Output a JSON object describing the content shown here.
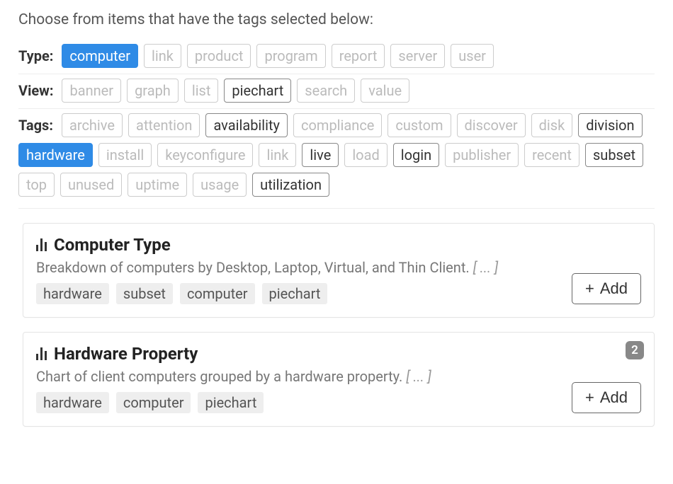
{
  "instruction": "Choose from items that have the tags selected below:",
  "filters": {
    "type": {
      "label": "Type:",
      "items": [
        {
          "label": "computer",
          "state": "selected"
        },
        {
          "label": "link",
          "state": "disabled"
        },
        {
          "label": "product",
          "state": "disabled"
        },
        {
          "label": "program",
          "state": "disabled"
        },
        {
          "label": "report",
          "state": "disabled"
        },
        {
          "label": "server",
          "state": "disabled"
        },
        {
          "label": "user",
          "state": "disabled"
        }
      ]
    },
    "view": {
      "label": "View:",
      "items": [
        {
          "label": "banner",
          "state": "disabled"
        },
        {
          "label": "graph",
          "state": "disabled"
        },
        {
          "label": "list",
          "state": "disabled"
        },
        {
          "label": "piechart",
          "state": "available"
        },
        {
          "label": "search",
          "state": "disabled"
        },
        {
          "label": "value",
          "state": "disabled"
        }
      ]
    },
    "tags": {
      "label": "Tags:",
      "items": [
        {
          "label": "archive",
          "state": "disabled"
        },
        {
          "label": "attention",
          "state": "disabled"
        },
        {
          "label": "availability",
          "state": "available"
        },
        {
          "label": "compliance",
          "state": "disabled"
        },
        {
          "label": "custom",
          "state": "disabled"
        },
        {
          "label": "discover",
          "state": "disabled"
        },
        {
          "label": "disk",
          "state": "disabled"
        },
        {
          "label": "division",
          "state": "available"
        },
        {
          "label": "hardware",
          "state": "selected"
        },
        {
          "label": "install",
          "state": "disabled"
        },
        {
          "label": "keyconfigure",
          "state": "disabled"
        },
        {
          "label": "link",
          "state": "disabled"
        },
        {
          "label": "live",
          "state": "available"
        },
        {
          "label": "load",
          "state": "disabled"
        },
        {
          "label": "login",
          "state": "available"
        },
        {
          "label": "publisher",
          "state": "disabled"
        },
        {
          "label": "recent",
          "state": "disabled"
        },
        {
          "label": "subset",
          "state": "available"
        },
        {
          "label": "top",
          "state": "disabled"
        },
        {
          "label": "unused",
          "state": "disabled"
        },
        {
          "label": "uptime",
          "state": "disabled"
        },
        {
          "label": "usage",
          "state": "disabled"
        },
        {
          "label": "utilization",
          "state": "available"
        }
      ]
    }
  },
  "cards": [
    {
      "title": "Computer Type",
      "description": "Breakdown of computers by Desktop, Laptop, Virtual, and Thin Client. ",
      "more": "[ ... ]",
      "tags": [
        "hardware",
        "subset",
        "computer",
        "piechart"
      ],
      "add_label": "Add",
      "badge": null
    },
    {
      "title": "Hardware Property",
      "description": "Chart of client computers grouped by a hardware property. ",
      "more": "[ ... ]",
      "tags": [
        "hardware",
        "computer",
        "piechart"
      ],
      "add_label": "Add",
      "badge": "2"
    }
  ]
}
